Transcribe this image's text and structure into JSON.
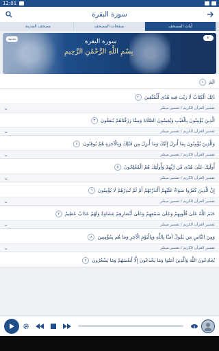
{
  "status": {
    "time": "12:01"
  },
  "header": {
    "title": "سورة البقرة"
  },
  "tabs": [
    {
      "label": "مصحف المدينة"
    },
    {
      "label": "صفحات المصحف"
    },
    {
      "label": "آيات المصحف"
    }
  ],
  "hero": {
    "surah_name": "سورة البقرة",
    "basmala": "بِسْمِ اللَّهِ الرَّحْمَٰنِ الرَّحِيمِ",
    "surah_number": "٢",
    "meta_label": "مدنية"
  },
  "ayat": [
    {
      "text": "الٓمٓ",
      "number": "١",
      "tafsir": ""
    },
    {
      "text": "ذَٰلِكَ الْكِتَابُ لَا رَيْبَ فِيهِ هُدًى لِّلْمُتَّقِينَ",
      "number": "٢",
      "tafsir": "تفسير القرآن الكريم / تفسير ميسّر"
    },
    {
      "text": "الَّذِينَ يُؤْمِنُونَ بِالْغَيْبِ وَيُقِيمُونَ الصَّلَاةَ وَمِمَّا رَزَقْنَاهُمْ يُنفِقُونَ",
      "number": "٣",
      "tafsir": "تفسير القرآن الكريم / تفسير ميسّر"
    },
    {
      "text": "وَالَّذِينَ يُؤْمِنُونَ بِمَا أُنزِلَ إِلَيْكَ وَمَا أُنزِلَ مِن قَبْلِكَ وَبِالْآخِرَةِ هُمْ يُوقِنُونَ",
      "number": "٤",
      "tafsir": "تفسير القرآن الكريم / تفسير ميسّر"
    },
    {
      "text": "أُولَٰئِكَ عَلَىٰ هُدًى مِّن رَّبِّهِمْ وَأُولَٰئِكَ هُمُ الْمُفْلِحُونَ",
      "number": "٥",
      "tafsir": "تفسير القرآن الكريم / تفسير ميسّر"
    },
    {
      "text": "إِنَّ الَّذِينَ كَفَرُوا سَوَاءٌ عَلَيْهِمْ أَأَنذَرْتَهُمْ أَمْ لَمْ تُنذِرْهُمْ لَا يُؤْمِنُونَ",
      "number": "٦",
      "tafsir": "تفسير القرآن الكريم / تفسير ميسّر"
    },
    {
      "text": "خَتَمَ اللَّهُ عَلَىٰ قُلُوبِهِمْ وَعَلَىٰ سَمْعِهِمْ وَعَلَىٰ أَبْصَارِهِمْ غِشَاوَةٌ وَلَهُمْ عَذَابٌ عَظِيمٌ",
      "number": "٧",
      "tafsir": "تفسير القرآن الكريم / تفسير ميسّر"
    },
    {
      "text": "وَمِنَ النَّاسِ مَن يَقُولُ آمَنَّا بِاللَّهِ وَبِالْيَوْمِ الْآخِرِ وَمَا هُم بِمُؤْمِنِينَ",
      "number": "٨",
      "tafsir": "تفسير القرآن الكريم / تفسير ميسّر"
    },
    {
      "text": "يُخَادِعُونَ اللَّهَ وَالَّذِينَ آمَنُوا وَمَا يَخْدَعُونَ إِلَّا أَنفُسَهُمْ وَمَا يَشْعُرُونَ",
      "number": "٩",
      "tafsir": ""
    }
  ],
  "colors": {
    "primary": "#1f4e8a",
    "background": "#eef1f4"
  }
}
